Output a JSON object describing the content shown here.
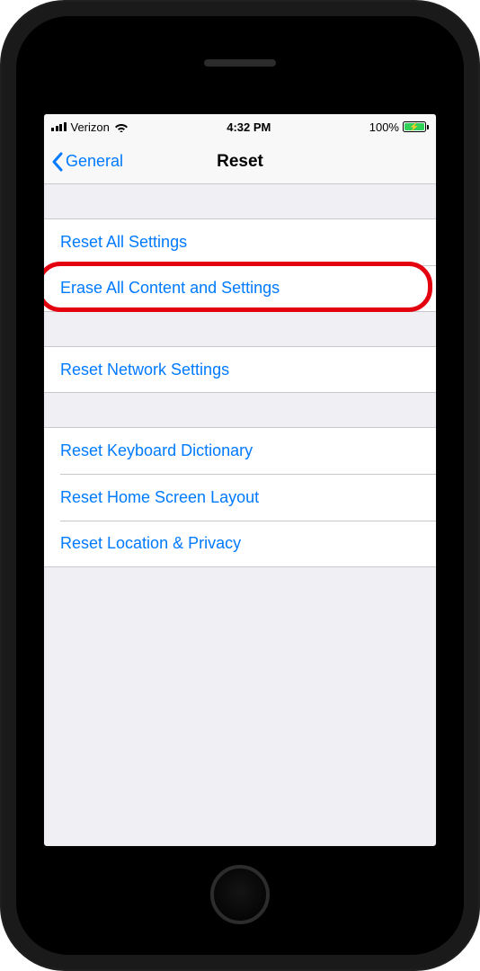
{
  "statusbar": {
    "carrier": "Verizon",
    "time": "4:32 PM",
    "battery_pct": "100%"
  },
  "nav": {
    "back_label": "General",
    "title": "Reset"
  },
  "groups": [
    {
      "rows": [
        {
          "id": "reset-all-settings",
          "label": "Reset All Settings"
        },
        {
          "id": "erase-all-content",
          "label": "Erase All Content and Settings",
          "highlighted": true
        }
      ]
    },
    {
      "rows": [
        {
          "id": "reset-network-settings",
          "label": "Reset Network Settings"
        }
      ]
    },
    {
      "rows": [
        {
          "id": "reset-keyboard-dict",
          "label": "Reset Keyboard Dictionary"
        },
        {
          "id": "reset-home-layout",
          "label": "Reset Home Screen Layout"
        },
        {
          "id": "reset-location-privacy",
          "label": "Reset Location & Privacy"
        }
      ]
    }
  ],
  "highlight_color": "#e3000f",
  "link_color": "#007aff"
}
